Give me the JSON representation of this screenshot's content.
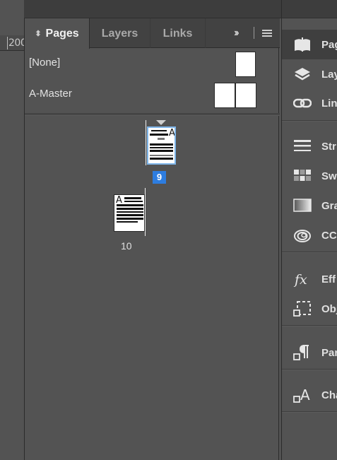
{
  "ruler": {
    "value": "200"
  },
  "panel": {
    "tabs": [
      {
        "label": "Pages",
        "active": true
      },
      {
        "label": "Layers",
        "active": false
      },
      {
        "label": "Links",
        "active": false
      }
    ],
    "expand_glyph": "››",
    "masters": [
      {
        "label": "[None]"
      },
      {
        "label": "A-Master"
      }
    ],
    "pages": [
      {
        "number": "9",
        "master_prefix": "A",
        "selected": true
      },
      {
        "number": "10",
        "master_prefix": "A",
        "selected": false
      }
    ]
  },
  "dock": {
    "items": [
      {
        "label": "Pag",
        "icon": "pages-icon",
        "active": true
      },
      {
        "label": "Lay",
        "icon": "layers-icon",
        "active": false
      },
      {
        "label": "Lin",
        "icon": "links-icon",
        "active": false
      },
      {
        "label": "Str",
        "icon": "stroke-icon",
        "active": false
      },
      {
        "label": "Sw",
        "icon": "swatches-icon",
        "active": false
      },
      {
        "label": "Gra",
        "icon": "gradient-icon",
        "active": false
      },
      {
        "label": "CC",
        "icon": "cc-libraries-icon",
        "active": false
      },
      {
        "label": "Eff",
        "icon": "effects-icon",
        "active": false
      },
      {
        "label": "Obj",
        "icon": "object-styles-icon",
        "active": false
      },
      {
        "label": "Par",
        "icon": "paragraph-styles-icon",
        "active": false
      },
      {
        "label": "Cha",
        "icon": "character-styles-icon",
        "active": false
      }
    ]
  },
  "colors": {
    "selection_blue": "#2d7de0",
    "thumb_highlight": "#7fb6ea",
    "panel_bg": "#535353"
  }
}
